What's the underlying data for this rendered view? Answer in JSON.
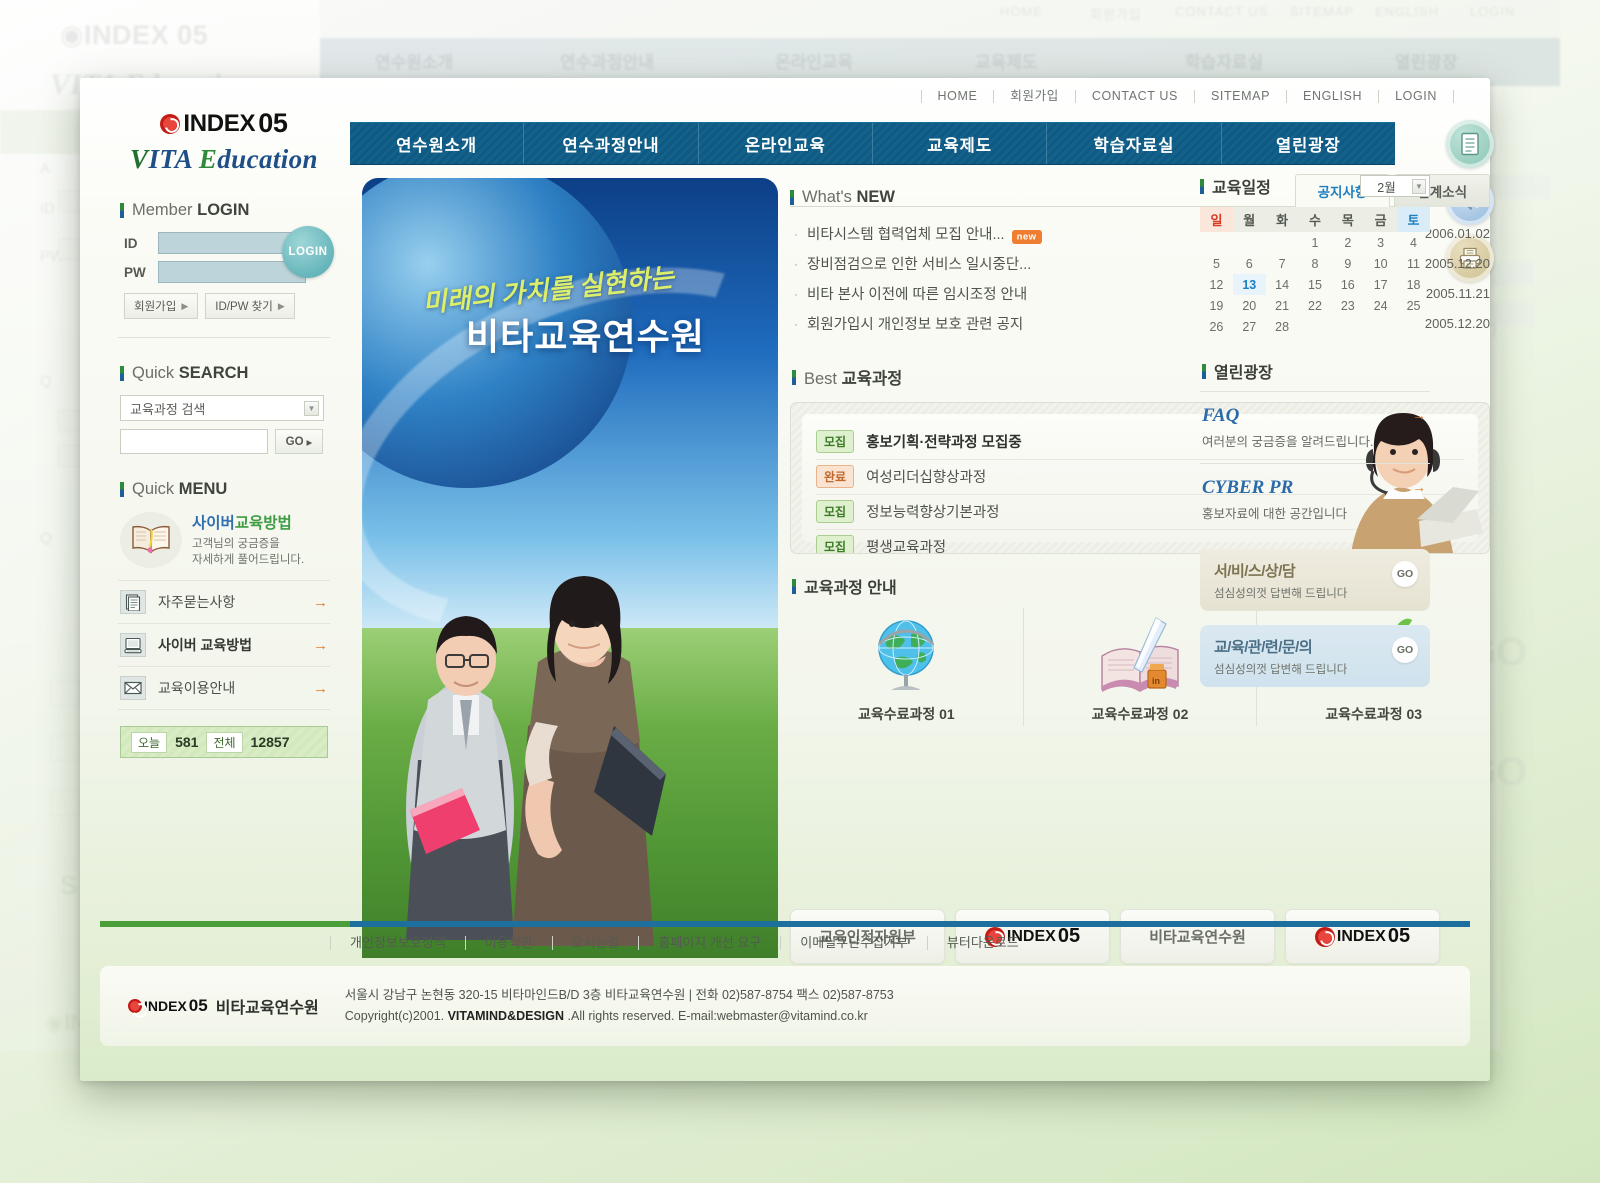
{
  "brand": {
    "logo_text": "INDEX",
    "logo_num": "05",
    "vita": {
      "v1": "V",
      "v2": "ITA ",
      "v3": "E",
      "v4": "ducation"
    },
    "vita_full": "VITA Education"
  },
  "toplinks": [
    "HOME",
    "회원가입",
    "CONTACT US",
    "SITEMAP",
    "ENGLISH",
    "LOGIN"
  ],
  "nav": [
    "연수원소개",
    "연수과정안내",
    "온라인교육",
    "교육제도",
    "학습자료실",
    "열린광장"
  ],
  "toolbuttons": [
    {
      "name": "document-icon",
      "label": "자료"
    },
    {
      "name": "sound-icon",
      "label": "소리"
    },
    {
      "name": "printer-icon",
      "label": "인쇄"
    }
  ],
  "sidebar": {
    "login": {
      "title_light": "Member ",
      "title_bold": "LOGIN",
      "id_label": "ID",
      "pw_label": "PW",
      "id_value": "",
      "pw_value": "",
      "button": "LOGIN",
      "join": "회원가입",
      "findidpw": "ID/PW 찾기"
    },
    "search": {
      "title_light": "Quick ",
      "title_bold": "SEARCH",
      "select_value": "교육과정 검색",
      "input_value": "",
      "go": "GO"
    },
    "menu": {
      "title_light": "Quick ",
      "title_bold": "MENU",
      "promo_title_a": "사이버",
      "promo_title_b": "교육방법",
      "promo_sub_1": "고객님의 궁금증을",
      "promo_sub_2": "자세하게 풀어드립니다.",
      "items": [
        {
          "label": "자주묻는사항",
          "icon": "document-icon",
          "bold": false
        },
        {
          "label": "사이버 교육방법",
          "icon": "monitor-icon",
          "bold": true
        },
        {
          "label": "교육이용안내",
          "icon": "mail-icon",
          "bold": false
        }
      ]
    },
    "counter": {
      "today_label": "오늘",
      "today_value": "581",
      "total_label": "전체",
      "total_value": "12857"
    }
  },
  "hero": {
    "line1": "미래의 가치를 실현하는",
    "line2": "비타교육연수원"
  },
  "news": {
    "title_light": "What's ",
    "title_bold": "NEW",
    "tabs": [
      {
        "label": "공지사항",
        "active": true
      },
      {
        "label": "업계소식",
        "active": false
      }
    ],
    "items": [
      {
        "title": "비타시스템 협력업체 모집 안내...",
        "date": "2006.01.02",
        "new": "new"
      },
      {
        "title": "장비점검으로 인한 서비스 일시중단...",
        "date": "2005.12.20",
        "new": ""
      },
      {
        "title": "비타 본사 이전에 따른 임시조정 안내",
        "date": "2005.11.21",
        "new": ""
      },
      {
        "title": "회원가입시 개인정보 보호 관련 공지",
        "date": "2005.12.20",
        "new": ""
      }
    ]
  },
  "best": {
    "title_light": "Best ",
    "title_bold": "교육과정",
    "items": [
      {
        "chip": "모집",
        "chip_type": "green",
        "name": "홍보기획·전략과정 모집중",
        "bold": true
      },
      {
        "chip": "완료",
        "chip_type": "orange",
        "name": "여성리더십향상과정",
        "bold": false
      },
      {
        "chip": "모집",
        "chip_type": "green",
        "name": "정보능력향상기본과정",
        "bold": false
      },
      {
        "chip": "모집",
        "chip_type": "green",
        "name": "평생교육과정",
        "bold": false
      }
    ]
  },
  "courses": {
    "title": "교육과정 안내",
    "items": [
      {
        "caption": "교육수료과정 01",
        "icon": "globe-icon"
      },
      {
        "caption": "교육수료과정 02",
        "icon": "book-pen-icon"
      },
      {
        "caption": "교육수료과정 03",
        "icon": "computer-rainbow-icon"
      }
    ]
  },
  "banners": [
    {
      "type": "text",
      "label": "교육인적자원부"
    },
    {
      "type": "logo",
      "label": "INDEX",
      "num": "05"
    },
    {
      "type": "text",
      "label": "비타교육연수원"
    },
    {
      "type": "logo",
      "label": "INDEX",
      "num": "05"
    }
  ],
  "calendar": {
    "title": "교육일정",
    "month": "2월",
    "weekdays": [
      "일",
      "월",
      "화",
      "수",
      "목",
      "금",
      "토"
    ],
    "weeks": [
      [
        "",
        "",
        "",
        "1",
        "2",
        "3",
        "4"
      ],
      [
        "5",
        "6",
        "7",
        "8",
        "9",
        "10",
        "11"
      ],
      [
        "12",
        "13",
        "14",
        "15",
        "16",
        "17",
        "18"
      ],
      [
        "19",
        "20",
        "21",
        "22",
        "23",
        "24",
        "25"
      ],
      [
        "26",
        "27",
        "28",
        "",
        "",
        "",
        ""
      ]
    ],
    "today": "13"
  },
  "plaza": {
    "title": "열린광장",
    "items": [
      {
        "head": "FAQ",
        "sub": "여러분의 궁금증을 알려드립니다."
      },
      {
        "head": "CYBER PR",
        "sub": "홍보자료에 대한 공간입니다"
      }
    ]
  },
  "ctas": [
    {
      "head": "서/비/스/상/담",
      "sub": "섬심성의껏 답변해 드립니다",
      "go": "GO",
      "style": "beige"
    },
    {
      "head": "교/육/관/련/문/의",
      "sub": "섬심성의껏 답변해 드립니다",
      "go": "GO",
      "style": "blue"
    }
  ],
  "footer": {
    "links": [
      "개인정보보호정책",
      "이용약관",
      "오시는길",
      "홈페이지 개선 요구",
      "이메일무단수집거부",
      "뷰터다운로드"
    ],
    "org": "비타교육연수원",
    "address": "서울시 강남구 논현동 320-15 비타마인드B/D 3층 비타교육연수원  |  전화 02)587-8754 팩스 02)587-8753",
    "copyright_pre": "Copyright(c)2001. ",
    "copyright_brand": "VITAMIND&DESIGN",
    "copyright_post": " .All rights reserved. E-mail:webmaster@vitamind.co.kr"
  },
  "colors": {
    "nav_blue": "#14618b",
    "accent_green": "#4c9e3a",
    "accent_blue": "#1d6f9e",
    "arrow_orange": "#e07a29",
    "badge_new": "#ef7e32",
    "chip_green": "#3c7a28",
    "chip_orange": "#c2672a"
  }
}
